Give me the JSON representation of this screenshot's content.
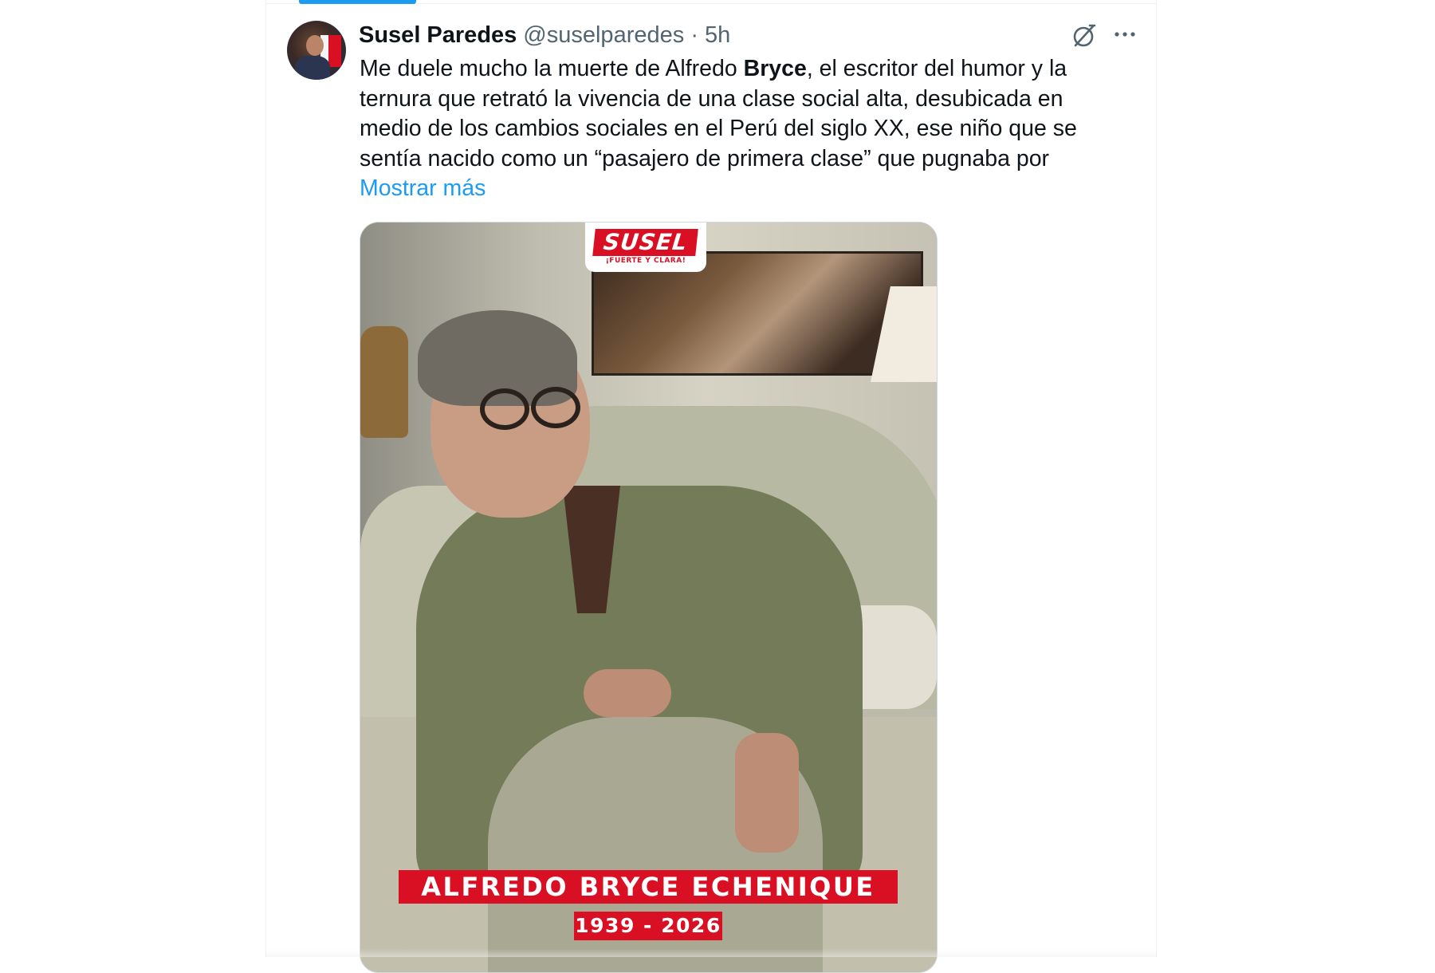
{
  "tweet": {
    "author_name": "Susel Paredes",
    "author_handle": "@suselparedes",
    "separator": "·",
    "time": "5h",
    "text": {
      "line1_before": "Me duele mucho la muerte de Alfredo ",
      "line1_bold": "Bryce",
      "line1_after": ", el escritor del humor y la",
      "line2": "ternura que retrató la vivencia de una clase social alta, desubicada en",
      "line3": "medio de los cambios sociales en el Perú del siglo XX, ese niño que se",
      "line4": "sentía nacido como un “pasajero de primera clase” que pugnaba por"
    },
    "show_more": "Mostrar más"
  },
  "media": {
    "logo_main": "SUSEL",
    "logo_sub": "¡FUERTE Y CLARA!",
    "caption_name": "ALFREDO BRYCE ECHENIQUE",
    "caption_years": "1939 - 2026",
    "brand_red": "#d91023"
  },
  "icons": {
    "grok": "grok-icon",
    "more": "more-icon"
  },
  "colors": {
    "accent": "#1d9bf0",
    "text_primary": "#0f1419",
    "text_secondary": "#536471"
  }
}
